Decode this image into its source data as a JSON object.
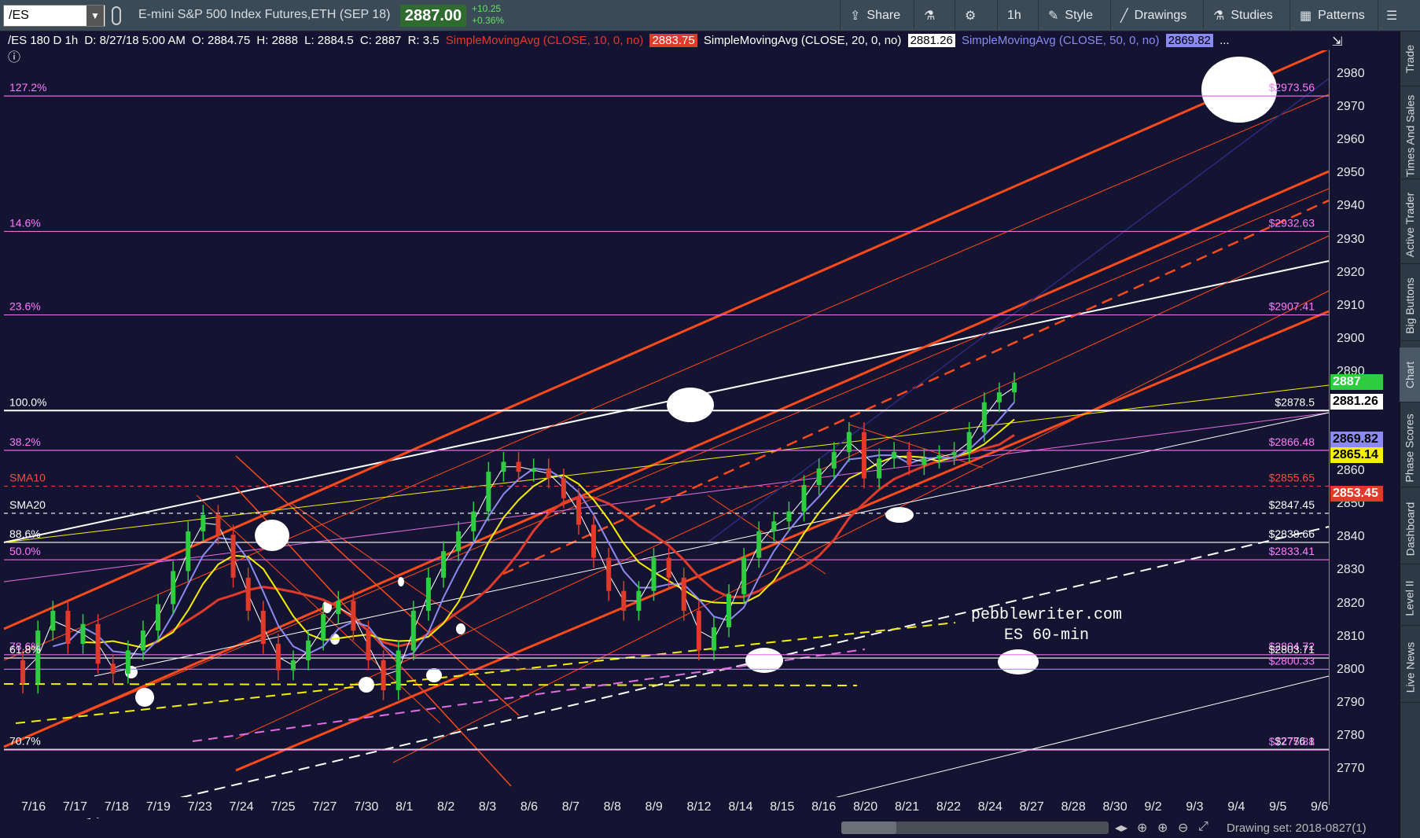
{
  "toolbar": {
    "symbol": "/ES",
    "instrument_title": "E-mini S&P 500 Index Futures,ETH (SEP 18)",
    "last_price": "2887.00",
    "net_change": "+10.25",
    "net_change_pct": "+0.36%",
    "buttons": {
      "share": "Share",
      "timeframe": "1h",
      "style": "Style",
      "drawings": "Drawings",
      "studies": "Studies",
      "patterns": "Patterns"
    }
  },
  "study_header": {
    "bar_info": "/ES 180 D 1h",
    "date": "D: 8/27/18 5:00 AM",
    "open": "O: 2884.75",
    "high": "H: 2888",
    "low": "L: 2884.5",
    "close": "C: 2887",
    "range": "R: 3.5",
    "sma10_label": "SimpleMovingAvg (CLOSE, 10, 0, no)",
    "sma10_value": "2883.75",
    "sma20_label": "SimpleMovingAvg (CLOSE, 20, 0, no)",
    "sma20_value": "2881.26",
    "sma50_label": "SimpleMovingAvg (CLOSE, 50, 0, no)",
    "sma50_value": "2869.82",
    "more": "..."
  },
  "colors": {
    "background": "#141432",
    "toolbar": "#3b4a57",
    "fib_magenta": "#e36de3",
    "channel_red": "#ff4a1a",
    "sma_yellow": "#f5f000",
    "sma_blue": "#8a8af2",
    "up_candle": "#2ecc40",
    "down_candle": "#e03b2a"
  },
  "chart_data": {
    "type": "line",
    "price_axis_ticks": [
      "2980",
      "2970",
      "2960",
      "2950",
      "2940",
      "2930",
      "2920",
      "2910",
      "2900",
      "2890",
      "2880",
      "2870",
      "2860",
      "2850",
      "2840",
      "2830",
      "2820",
      "2810",
      "2800",
      "2790",
      "2780",
      "2770"
    ],
    "date_ticks": [
      "7/16",
      "7/17",
      "7/18",
      "7/19",
      "7/23",
      "7/24",
      "7/25",
      "7/27",
      "7/30",
      "8/1",
      "8/2",
      "8/3",
      "8/6",
      "8/7",
      "8/8",
      "8/9",
      "8/12",
      "8/14",
      "8/15",
      "8/16",
      "8/20",
      "8/21",
      "8/22",
      "8/24",
      "8/27",
      "8/28",
      "8/30",
      "9/2",
      "9/3",
      "9/4",
      "9/5",
      "9/6"
    ],
    "ylim": [
      2765,
      2985
    ],
    "horizontal_levels": [
      {
        "left_label": "127.2%",
        "right_label": "$2973.56",
        "price": 2973.56,
        "color": "#e36de3"
      },
      {
        "left_label": "14.6%",
        "right_label": "$2932.63",
        "price": 2932.63,
        "color": "#e36de3"
      },
      {
        "left_label": "23.6%",
        "right_label": "$2907.41",
        "price": 2907.41,
        "color": "#e36de3"
      },
      {
        "left_label": "100.0%",
        "right_label": "$2878.5",
        "price": 2878.5,
        "color": "#ffffff"
      },
      {
        "left_label": "38.2%",
        "right_label": "$2866.48",
        "price": 2866.48,
        "color": "#e36de3"
      },
      {
        "left_label": "SMA10",
        "right_label": "$2855.65",
        "price": 2855.65,
        "color": "#e03b2a"
      },
      {
        "left_label": "SMA20",
        "right_label": "$2847.45",
        "price": 2847.45,
        "color": "#ffffff"
      },
      {
        "left_label": "88.6%",
        "right_label": "$2838.66",
        "price": 2838.66,
        "color": "#ffffff"
      },
      {
        "left_label": "50.0%",
        "right_label": "$2833.41",
        "price": 2833.41,
        "color": "#e36de3"
      },
      {
        "left_label": "78.6%",
        "right_label": "$2804.72",
        "price": 2804.72,
        "color": "#e36de3"
      },
      {
        "left_label": "61.8%",
        "right_label": "$2803.71",
        "price": 2803.71,
        "color": "#ffffff"
      },
      {
        "left_label": "",
        "right_label": "$2800.33",
        "price": 2800.33,
        "color": "#e36de3"
      },
      {
        "left_label": "70.7%",
        "right_label": "$2776.1",
        "price": 2776.1,
        "color": "#ffffff"
      },
      {
        "left_label": "",
        "right_label": "$2775.88",
        "price": 2775.88,
        "color": "#e36de3"
      }
    ],
    "price_tags": [
      {
        "label": "2887",
        "price": 2887,
        "bg": "#2ecc40",
        "fg": "#ffffff"
      },
      {
        "label": "2881.26",
        "price": 2881.26,
        "bg": "#ffffff",
        "fg": "#000000"
      },
      {
        "label": "2869.82",
        "price": 2869.82,
        "bg": "#8a8af2",
        "fg": "#000000"
      },
      {
        "label": "2865.14",
        "price": 2865.14,
        "bg": "#f5f000",
        "fg": "#000000"
      },
      {
        "label": "2853.45",
        "price": 2853.45,
        "bg": "#e03b2a",
        "fg": "#ffffff"
      }
    ],
    "annotation_lines": [
      "pebblewriter.com",
      "ES 60-min"
    ],
    "price_series": [
      2803,
      2796,
      2812,
      2818,
      2808,
      2814,
      2802,
      2799,
      2806,
      2812,
      2820,
      2830,
      2842,
      2847,
      2841,
      2828,
      2818,
      2808,
      2800,
      2803,
      2809,
      2817,
      2821,
      2812,
      2803,
      2794,
      2806,
      2818,
      2828,
      2836,
      2842,
      2848,
      2860,
      2863,
      2860,
      2861,
      2858,
      2852,
      2844,
      2834,
      2824,
      2818,
      2824,
      2834,
      2828,
      2818,
      2806,
      2813,
      2823,
      2834,
      2842,
      2845,
      2848,
      2856,
      2861,
      2866,
      2872,
      2858,
      2864,
      2866,
      2862,
      2864,
      2865,
      2866,
      2872,
      2881,
      2884,
      2887
    ]
  },
  "sidebar": {
    "tabs": [
      "Trade",
      "Times And Sales",
      "Active Trader",
      "Big Buttons",
      "Chart",
      "Phase Scores",
      "Dashboard",
      "Level II",
      "Live News"
    ]
  },
  "footer": {
    "drawing_set": "Drawing set: 2018-0827(1)"
  }
}
